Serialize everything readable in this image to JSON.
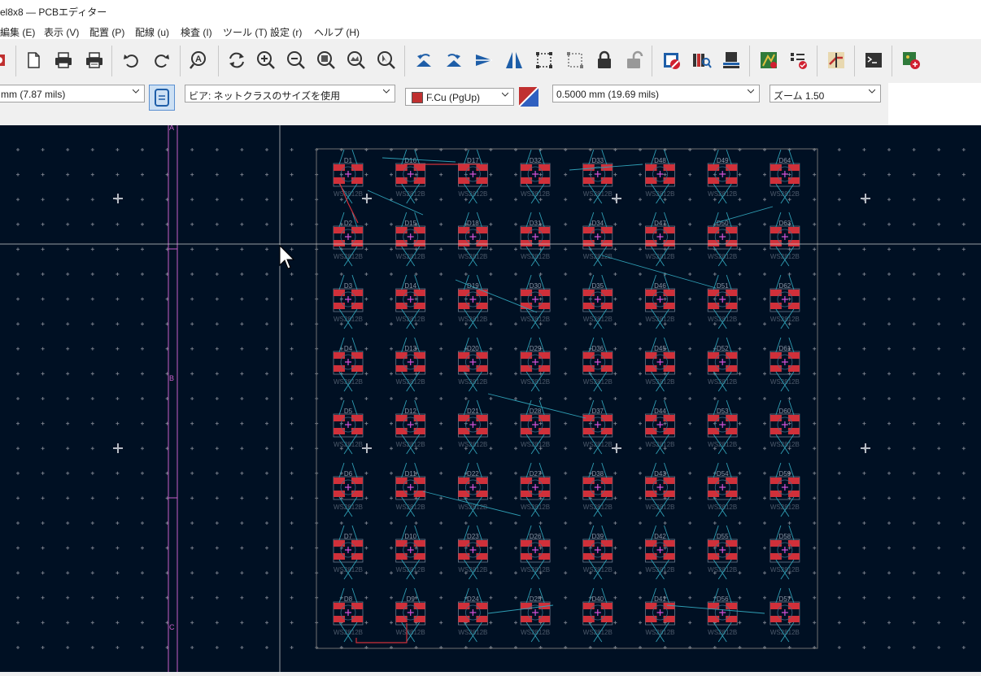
{
  "window": {
    "title": "el8x8 — PCBエディター"
  },
  "menu": [
    "編集 (E)",
    "表示 (V)",
    "配置 (P)",
    "配線 (u)",
    "検査 (I)",
    "ツール (T)",
    "設定 (r)",
    "ヘルプ (H)"
  ],
  "toolbar_icons": [
    "board-setup-icon",
    "new-page-icon",
    "print-icon",
    "plot-icon",
    "undo-icon",
    "redo-icon",
    "find-icon",
    "refresh-icon",
    "zoom-in-icon",
    "zoom-out-icon",
    "zoom-fit-icon",
    "zoom-objects-icon",
    "zoom-selection-icon",
    "rotate-ccw-icon",
    "rotate-cw-icon",
    "flip-icon",
    "mirror-icon",
    "group-icon",
    "ungroup-icon",
    "lock-icon",
    "unlock-icon",
    "drc-icon",
    "footprint-library-icon",
    "layer-stack-icon",
    "netlist-update-icon",
    "checklist-icon",
    "router-icon",
    "scripting-console-icon",
    "plugin-icon"
  ],
  "auxbar": {
    "track_width": "mm (7.87 mils)",
    "via_size": "ビア: ネットクラスのサイズを使用",
    "layer": "F.Cu (PgUp)",
    "grid": "0.5000 mm (19.69 mils)",
    "zoom": "ズーム 1.50"
  },
  "colors": {
    "canvas_bg": "#001023",
    "pad": "#d0303a",
    "track": "#2f9fb5",
    "via_cross": "#d450d4",
    "grid": "#8a8f9a",
    "frame_line": "#c860c8",
    "edge": "#707070"
  },
  "frame_labels": [
    "A",
    "B",
    "C"
  ],
  "board": {
    "columns": 8,
    "rows": 8,
    "designators": [
      [
        "D1",
        "D16",
        "D17",
        "D32",
        "D33",
        "D48",
        "D49",
        "D64"
      ],
      [
        "D2",
        "D15",
        "D18",
        "D31",
        "D34",
        "D47",
        "D50",
        "D63"
      ],
      [
        "D3",
        "D14",
        "D19",
        "D30",
        "D35",
        "D46",
        "D51",
        "D62"
      ],
      [
        "D4",
        "D13",
        "D20",
        "D29",
        "D36",
        "D45",
        "D52",
        "D61"
      ],
      [
        "D5",
        "D12",
        "D21",
        "D28",
        "D37",
        "D44",
        "D53",
        "D60"
      ],
      [
        "D6",
        "D11",
        "D22",
        "D27",
        "D38",
        "D43",
        "D54",
        "D59"
      ],
      [
        "D7",
        "D10",
        "D23",
        "D26",
        "D39",
        "D42",
        "D55",
        "D58"
      ],
      [
        "D8",
        "D9",
        "D24",
        "D25",
        "D40",
        "D41",
        "D56",
        "D57"
      ]
    ],
    "value_label": "WS2812B"
  }
}
